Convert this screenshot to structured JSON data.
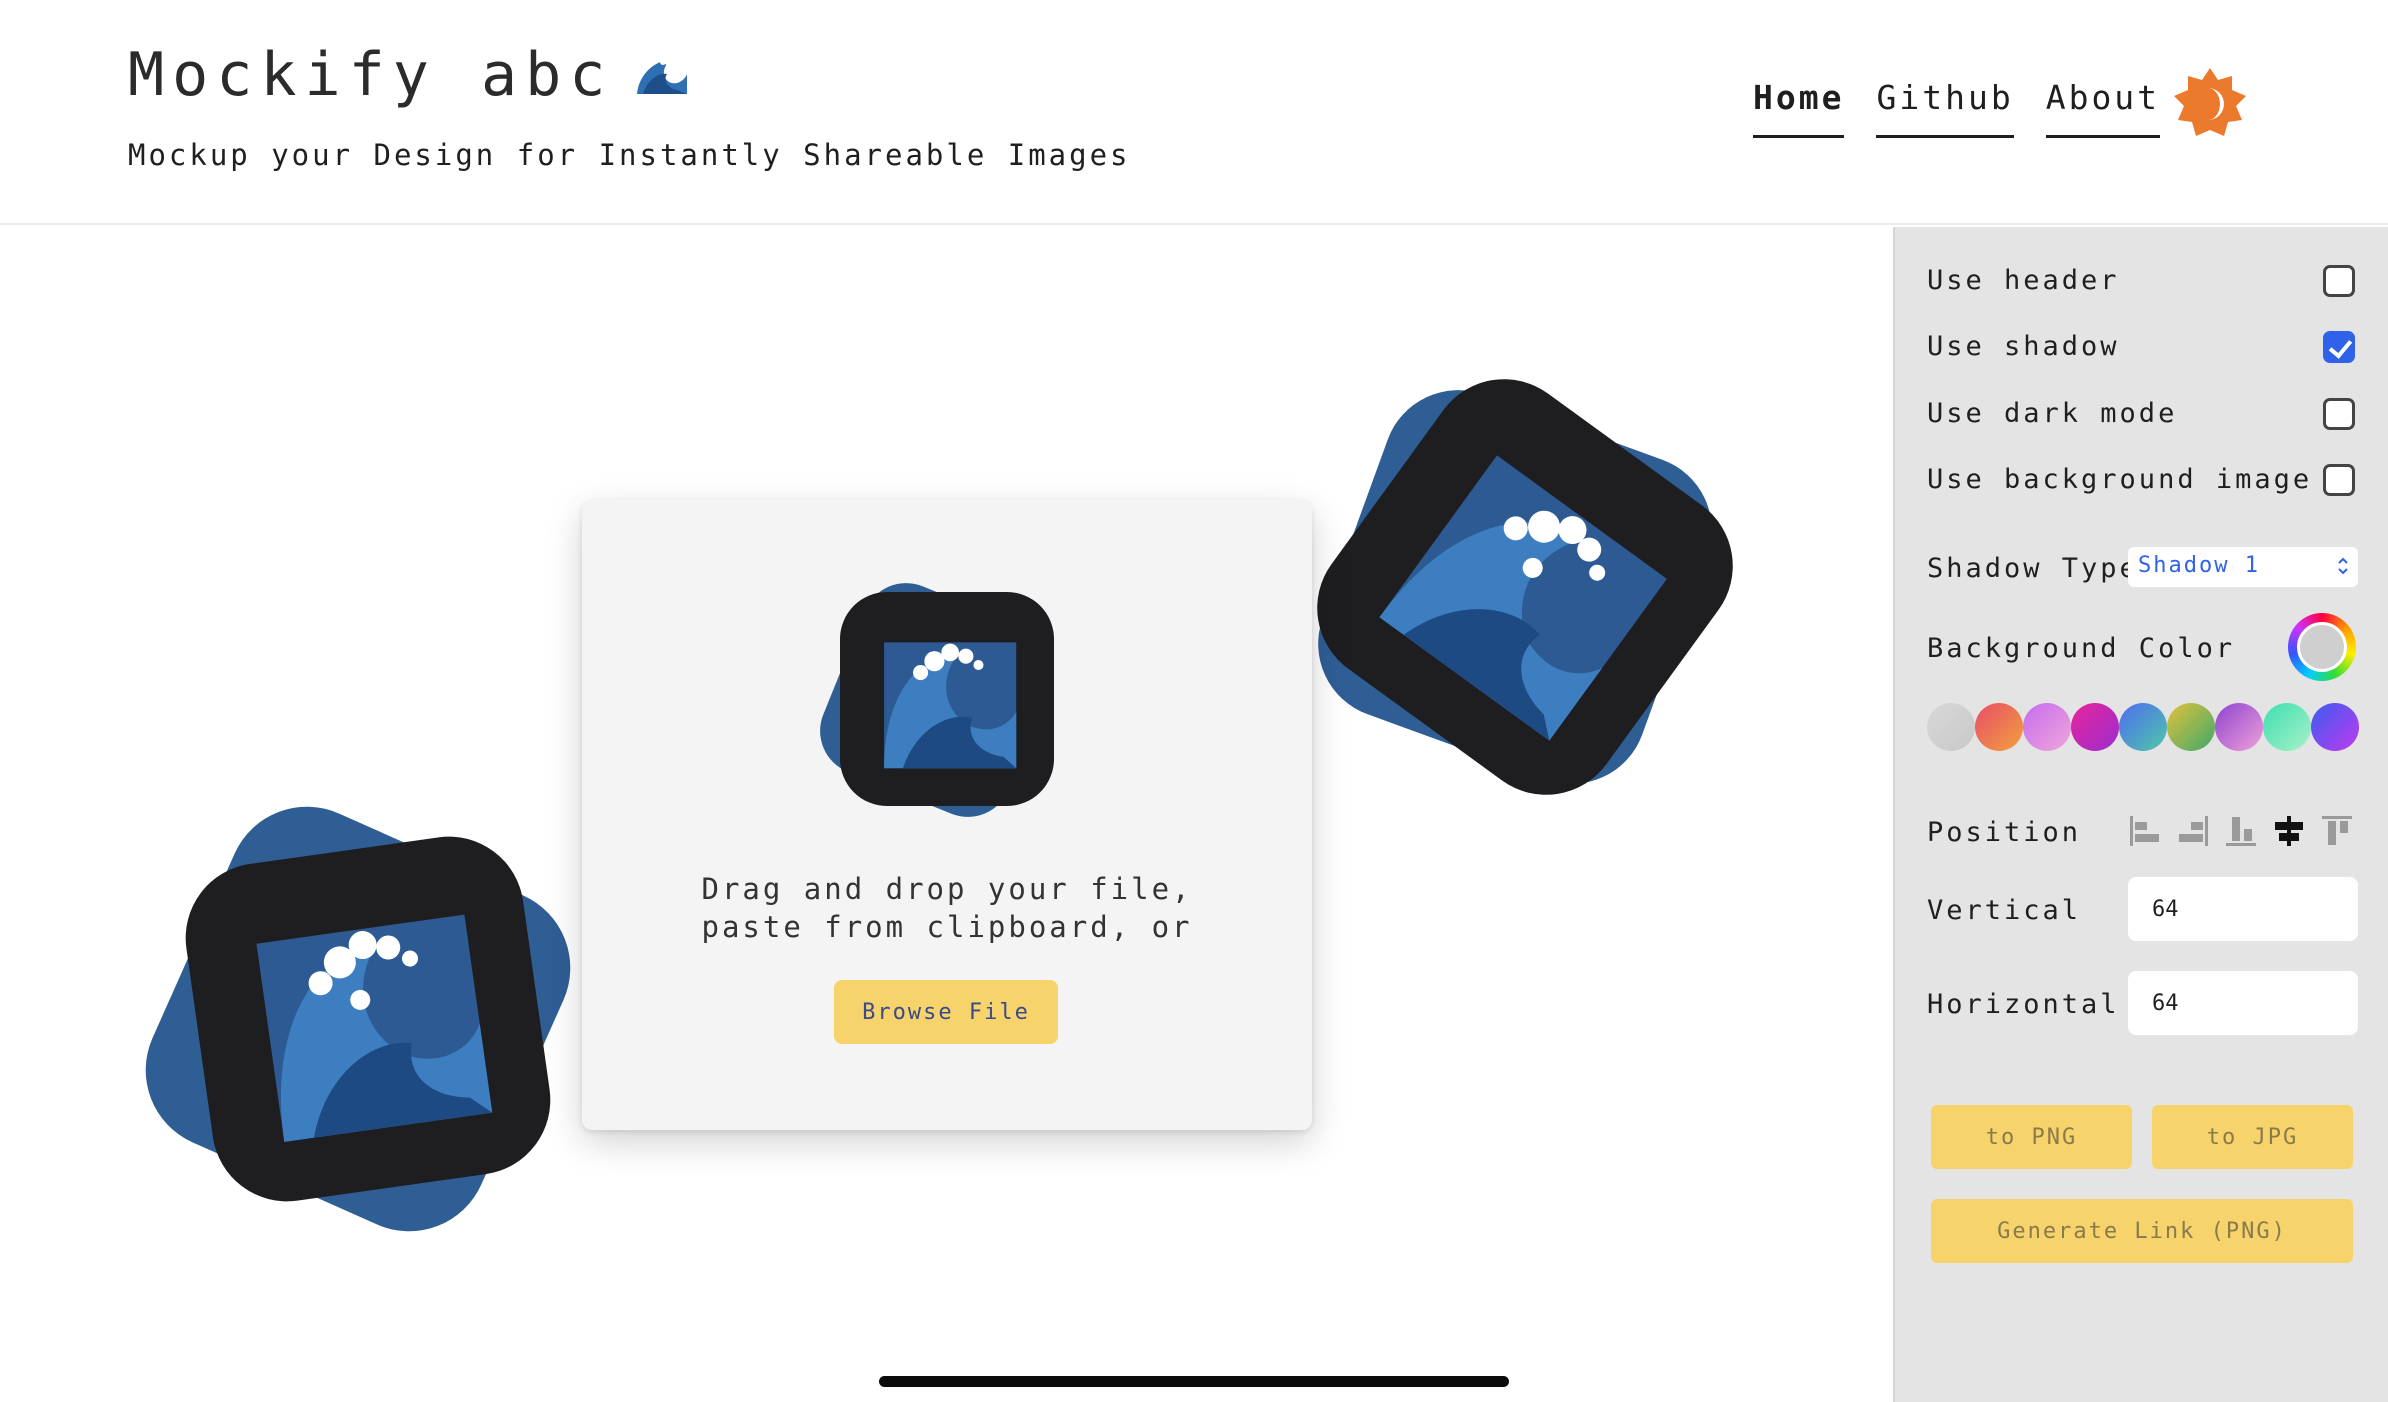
{
  "header": {
    "title": "Mockify abc",
    "title_emoji": "water-wave-icon",
    "subtitle": "Mockup your Design for Instantly Shareable Images",
    "nav": [
      {
        "label": "Home",
        "active": true
      },
      {
        "label": "Github",
        "active": false
      },
      {
        "label": "About",
        "active": false
      }
    ],
    "theme_icon": "sun-moon-icon",
    "accent_color": "#ec7a2c"
  },
  "dropzone": {
    "line1": "Drag and drop your file,",
    "line2": "paste from clipboard, or",
    "browse_label": "Browse File"
  },
  "settings": {
    "use_header": {
      "label": "Use header",
      "checked": false
    },
    "use_shadow": {
      "label": "Use shadow",
      "checked": true
    },
    "use_dark_mode": {
      "label": "Use dark mode",
      "checked": false
    },
    "use_background_image": {
      "label": "Use background image",
      "checked": false
    },
    "shadow_type": {
      "label": "Shadow Type",
      "value": "Shadow 1"
    },
    "background_color": {
      "label": "Background Color",
      "selected": "#cfcfcf",
      "swatches": [
        "linear-gradient(135deg,#d8d8d8,#c8c8c8)",
        "linear-gradient(135deg,#e84d6a,#f2a03d)",
        "linear-gradient(135deg,#c56cf0,#f0a6d8)",
        "linear-gradient(135deg,#e6259b,#9c2dcf)",
        "linear-gradient(135deg,#4d6cf0,#50c8a8)",
        "linear-gradient(135deg,#e2c23a,#3fa86b)",
        "linear-gradient(135deg,#8e44cf,#f0a0d8)",
        "linear-gradient(135deg,#3de0b0,#a8f0c8)",
        "linear-gradient(135deg,#3b5cf0,#c03af0)"
      ]
    },
    "position": {
      "label": "Position",
      "options": [
        "align-left-icon",
        "align-right-icon",
        "align-bottom-icon",
        "align-center-icon",
        "align-top-icon"
      ],
      "selected_index": 3
    },
    "vertical": {
      "label": "Vertical",
      "value": "64"
    },
    "horizontal": {
      "label": "Horizontal",
      "value": "64"
    },
    "export": {
      "png": "to PNG",
      "jpg": "to JPG",
      "link": "Generate Link (PNG)"
    }
  }
}
